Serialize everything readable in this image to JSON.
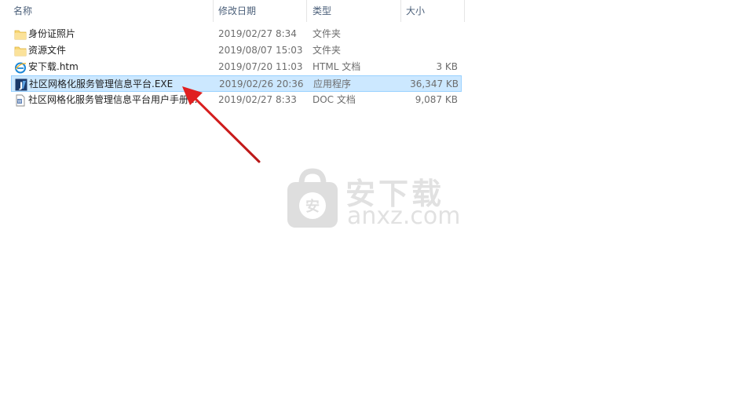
{
  "columns": {
    "name": "名称",
    "date": "修改日期",
    "type": "类型",
    "size": "大小"
  },
  "files": [
    {
      "name": "身份证照片",
      "date": "2019/02/27 8:34",
      "type": "文件夹",
      "size": "",
      "icon": "folder-icon"
    },
    {
      "name": "资源文件",
      "date": "2019/08/07 15:03",
      "type": "文件夹",
      "size": "",
      "icon": "folder-icon"
    },
    {
      "name": "安下载.htm",
      "date": "2019/07/20 11:03",
      "type": "HTML 文档",
      "size": "3 KB",
      "icon": "ie-html-icon"
    },
    {
      "name": "社区网格化服务管理信息平台.EXE",
      "date": "2019/02/26 20:36",
      "type": "应用程序",
      "size": "36,347 KB",
      "icon": "exe-app-icon",
      "selected": true
    },
    {
      "name": "社区网格化服务管理信息平台用户手册...",
      "date": "2019/02/27 8:33",
      "type": "DOC 文档",
      "size": "9,087 KB",
      "icon": "doc-icon"
    }
  ],
  "watermark": {
    "cn": "安下载",
    "en": "anxz.com",
    "badge": "安"
  },
  "colors": {
    "selection_bg": "#cce8ff",
    "folder": "#f8d775",
    "arrow": "#e02020"
  }
}
